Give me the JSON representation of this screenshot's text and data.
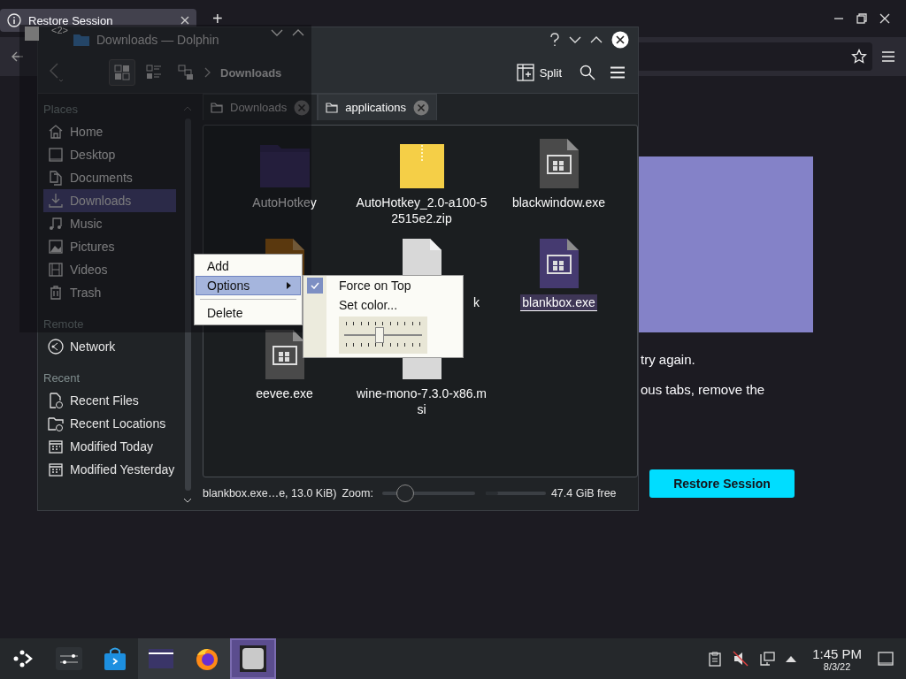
{
  "browser": {
    "tab": {
      "title": "Restore Session"
    },
    "new_tab": "+",
    "page": {
      "texts": [
        "try again.",
        "ous tabs, remove the"
      ],
      "restore_button": "Restore Session"
    }
  },
  "overlay_window": {
    "title": "<2>"
  },
  "dolphin": {
    "title": "Downloads — Dolphin",
    "breadcrumb": "Downloads",
    "split": "Split",
    "view_modes": [
      {
        "kind": "icons",
        "selected": true
      },
      {
        "kind": "compact",
        "selected": false
      },
      {
        "kind": "details",
        "selected": false
      }
    ],
    "tabs": [
      {
        "label": "Downloads",
        "selected": false
      },
      {
        "label": "applications",
        "selected": true
      }
    ],
    "sidebar": [
      {
        "title": "Places",
        "items": [
          {
            "label": "Home",
            "kind": "home",
            "selected": false
          },
          {
            "label": "Desktop",
            "kind": "desktop",
            "selected": false
          },
          {
            "label": "Documents",
            "kind": "documents",
            "selected": false
          },
          {
            "label": "Downloads",
            "kind": "downloads",
            "selected": true
          },
          {
            "label": "Music",
            "kind": "music",
            "selected": false
          },
          {
            "label": "Pictures",
            "kind": "pictures",
            "selected": false
          },
          {
            "label": "Videos",
            "kind": "videos",
            "selected": false
          },
          {
            "label": "Trash",
            "kind": "trash",
            "selected": false
          }
        ]
      },
      {
        "title": "Remote",
        "items": [
          {
            "label": "Network",
            "kind": "network",
            "selected": false
          }
        ]
      },
      {
        "title": "Recent",
        "items": [
          {
            "label": "Recent Files",
            "kind": "recent-files",
            "selected": false
          },
          {
            "label": "Recent Locations",
            "kind": "recent-locations",
            "selected": false
          },
          {
            "label": "Modified Today",
            "kind": "calendar",
            "selected": false
          },
          {
            "label": "Modified Yesterday",
            "kind": "calendar",
            "selected": false
          }
        ]
      }
    ],
    "files": [
      {
        "name": "AutoHotkey",
        "kind": "folder",
        "selected": false
      },
      {
        "name": "AutoHotkey_2.0-a100-52515e2.zip",
        "kind": "archive",
        "selected": false
      },
      {
        "name": "blackwindow.exe",
        "kind": "executable",
        "selected": false
      },
      {
        "kind": "script",
        "selected": false
      },
      {
        "name": "k",
        "kind": "package",
        "selected": false,
        "partial": true
      },
      {
        "name": "blankbox.exe",
        "kind": "executable",
        "selected": true
      },
      {
        "name": "eevee.exe",
        "kind": "executable",
        "selected": false
      },
      {
        "name": "wine-mono-7.3.0-x86.msi",
        "kind": "package",
        "selected": false
      }
    ],
    "status": {
      "text": "blankbox.exe…e, 13.0 KiB)",
      "zoom_label": "Zoom:",
      "zoom": {
        "level": 0.25
      },
      "space": {
        "level": 0.2
      },
      "free": "47.4 GiB free"
    }
  },
  "context_menu": {
    "items": [
      {
        "kind": "item",
        "label": "Add",
        "selected": false
      },
      {
        "kind": "submenu",
        "label": "Options",
        "selected": true
      },
      {
        "kind": "separator"
      },
      {
        "kind": "item",
        "label": "Delete",
        "selected": false
      }
    ]
  },
  "submenu": {
    "items": [
      {
        "kind": "check",
        "label": "Force on Top",
        "checked": true
      },
      {
        "kind": "item",
        "label": "Set color..."
      },
      {
        "kind": "slider",
        "level": 0.45
      }
    ]
  },
  "taskbar": {
    "apps": [
      {
        "kind": "launcher",
        "running": false,
        "selected": false
      },
      {
        "kind": "settings",
        "running": false,
        "selected": false
      },
      {
        "kind": "store",
        "running": false,
        "selected": false
      },
      {
        "kind": "files",
        "running": true,
        "selected": false
      },
      {
        "kind": "browser",
        "running": true,
        "selected": false
      },
      {
        "kind": "window",
        "running": true,
        "selected": true
      }
    ],
    "clock": {
      "time": "1:45 PM",
      "date": "8/3/22"
    }
  }
}
